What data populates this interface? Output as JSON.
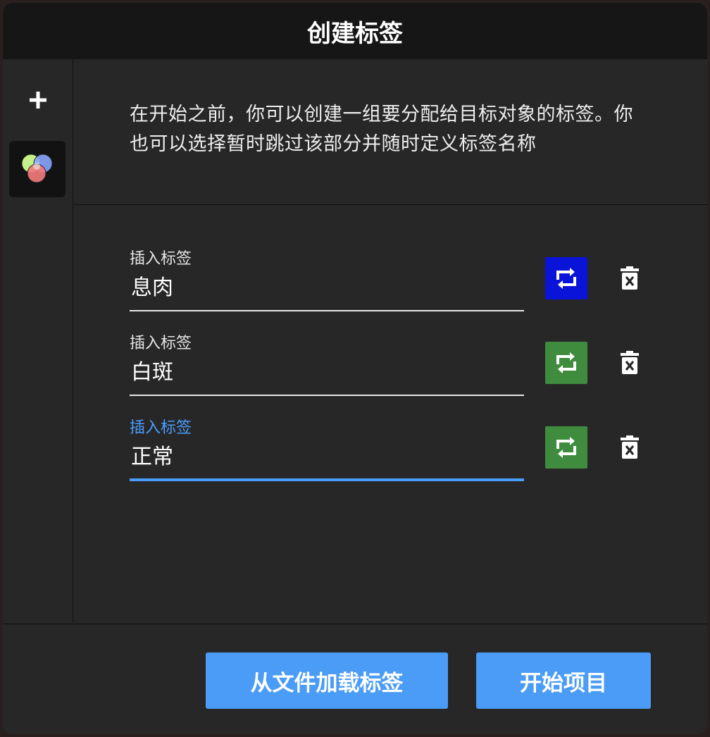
{
  "window": {
    "title": "创建标签"
  },
  "sidebar": {
    "add_icon": "plus-icon",
    "labels_icon": "color-circles-icon"
  },
  "intro": {
    "text": "在开始之前，你可以创建一组要分配给目标对象的标签。你也可以选择暂时跳过该部分并随时定义标签名称"
  },
  "labels": [
    {
      "field_label": "插入标签",
      "value": "息肉",
      "swap_color": "#0a14d8",
      "swap_icon": "swap-arrows-icon",
      "delete_icon": "trash-icon"
    },
    {
      "field_label": "插入标签",
      "value": "白斑",
      "swap_color": "#3f8c3f",
      "swap_icon": "swap-arrows-icon",
      "delete_icon": "trash-icon"
    },
    {
      "field_label": "插入标签",
      "value": "正常",
      "swap_color": "#3f8c3f",
      "swap_icon": "swap-arrows-icon",
      "delete_icon": "trash-icon"
    }
  ],
  "footer": {
    "load_button": "从文件加载标签",
    "start_button": "开始项目"
  },
  "colors": {
    "accent": "#4a9cf6",
    "focus": "#4a9eff",
    "background": "#272727",
    "titlebar": "#161616"
  }
}
